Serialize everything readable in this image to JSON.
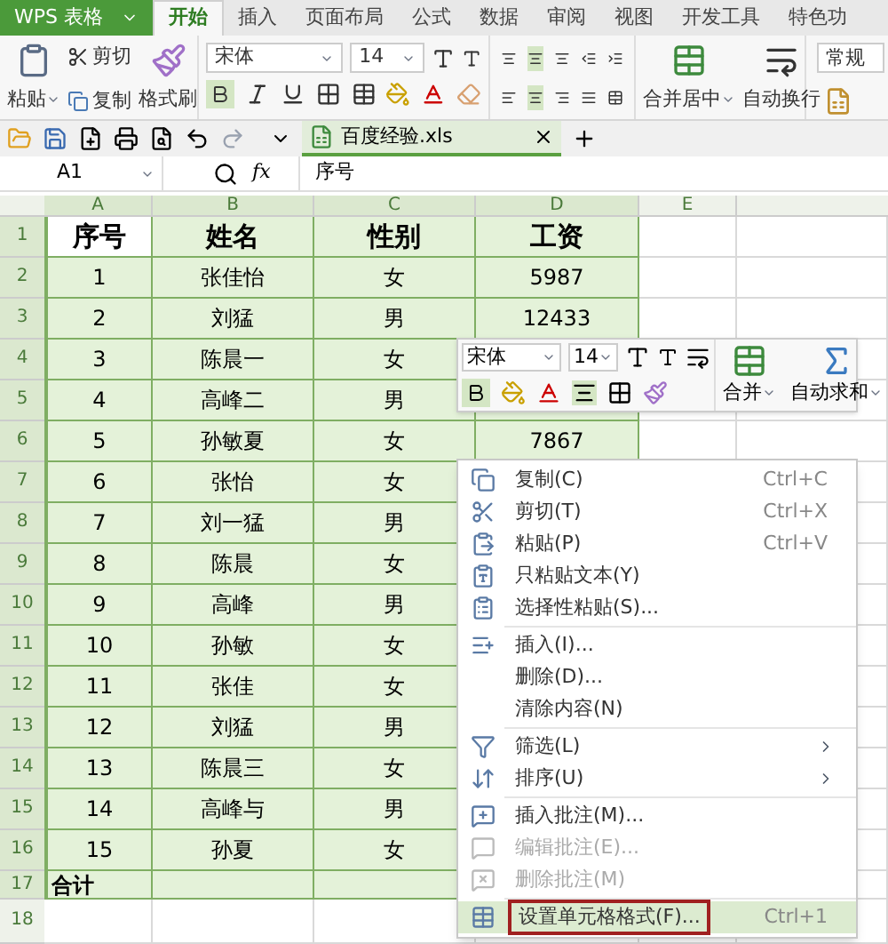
{
  "app_menu": {
    "label": "WPS 表格"
  },
  "tabs": [
    {
      "label": "开始",
      "selected": true
    },
    {
      "label": "插入",
      "selected": false
    },
    {
      "label": "页面布局",
      "selected": false
    },
    {
      "label": "公式",
      "selected": false
    },
    {
      "label": "数据",
      "selected": false
    },
    {
      "label": "审阅",
      "selected": false
    },
    {
      "label": "视图",
      "selected": false
    },
    {
      "label": "开发工具",
      "selected": false
    },
    {
      "label": "特色功",
      "selected": false
    }
  ],
  "ribbon": {
    "paste": "粘贴",
    "cut": "剪切",
    "copy": "复制",
    "format_painter": "格式刷",
    "font": "宋体",
    "size": "14",
    "merge": "合并居中",
    "wrap": "自动换行",
    "number_format": "常规"
  },
  "document_tab": {
    "title": "百度经验.xls"
  },
  "formula_bar": {
    "cell": "A1",
    "fx_label": "fx",
    "formula": "序号"
  },
  "columns": [
    "A",
    "B",
    "C",
    "D",
    "E"
  ],
  "rows": [
    {
      "number": "1",
      "kind": "header",
      "selected": true,
      "cells": [
        "序号",
        "姓名",
        "性别",
        "工资"
      ]
    },
    {
      "number": "2",
      "kind": "data",
      "selected": true,
      "cells": [
        "1",
        "张佳怡",
        "女",
        "5987"
      ]
    },
    {
      "number": "3",
      "kind": "data",
      "selected": true,
      "cells": [
        "2",
        "刘猛",
        "男",
        "12433"
      ]
    },
    {
      "number": "4",
      "kind": "data",
      "selected": true,
      "cells": [
        "3",
        "陈晨一",
        "女"
      ]
    },
    {
      "number": "5",
      "kind": "data",
      "selected": true,
      "cells": [
        "4",
        "高峰二",
        "男"
      ]
    },
    {
      "number": "6",
      "kind": "data",
      "selected": true,
      "cells": [
        "5",
        "孙敏夏",
        "女",
        "7867"
      ]
    },
    {
      "number": "7",
      "kind": "data",
      "selected": true,
      "cells": [
        "6",
        "张怡",
        "女"
      ]
    },
    {
      "number": "8",
      "kind": "data",
      "selected": true,
      "cells": [
        "7",
        "刘一猛",
        "男"
      ]
    },
    {
      "number": "9",
      "kind": "data",
      "selected": true,
      "cells": [
        "8",
        "陈晨",
        "女"
      ]
    },
    {
      "number": "10",
      "kind": "data",
      "selected": true,
      "cells": [
        "9",
        "高峰",
        "男"
      ]
    },
    {
      "number": "11",
      "kind": "data",
      "selected": true,
      "cells": [
        "10",
        "孙敏",
        "女"
      ]
    },
    {
      "number": "12",
      "kind": "data",
      "selected": true,
      "cells": [
        "11",
        "张佳",
        "女"
      ]
    },
    {
      "number": "13",
      "kind": "data",
      "selected": true,
      "cells": [
        "12",
        "刘猛",
        "男"
      ]
    },
    {
      "number": "14",
      "kind": "data",
      "selected": true,
      "cells": [
        "13",
        "陈晨三",
        "女"
      ]
    },
    {
      "number": "15",
      "kind": "data",
      "selected": true,
      "cells": [
        "14",
        "高峰与",
        "男"
      ]
    },
    {
      "number": "16",
      "kind": "data",
      "selected": true,
      "cells": [
        "15",
        "孙夏",
        "女"
      ]
    },
    {
      "number": "17",
      "kind": "total",
      "selected": true,
      "cells": [
        "合计"
      ]
    },
    {
      "number": "18",
      "kind": "data",
      "selected": false
    }
  ],
  "mini_toolbar": {
    "font": "宋体",
    "size": "14",
    "merge": "合并",
    "autosum": "自动求和"
  },
  "context_menu": [
    {
      "kind": "item",
      "label": "复制(C)",
      "shortcut": "Ctrl+C",
      "disabled": false,
      "submenu": false,
      "selected": false
    },
    {
      "kind": "item",
      "label": "剪切(T)",
      "shortcut": "Ctrl+X",
      "disabled": false,
      "submenu": false,
      "selected": false
    },
    {
      "kind": "item",
      "label": "粘贴(P)",
      "shortcut": "Ctrl+V",
      "disabled": false,
      "submenu": false,
      "selected": false
    },
    {
      "kind": "item",
      "label": "只粘贴文本(Y)",
      "disabled": false,
      "submenu": false,
      "selected": false
    },
    {
      "kind": "item",
      "label": "选择性粘贴(S)...",
      "disabled": false,
      "submenu": false,
      "selected": false
    },
    {
      "kind": "separator"
    },
    {
      "kind": "item",
      "label": "插入(I)...",
      "disabled": false,
      "submenu": false,
      "selected": false
    },
    {
      "kind": "item",
      "label": "删除(D)...",
      "disabled": false,
      "submenu": false,
      "selected": false
    },
    {
      "kind": "item",
      "label": "清除内容(N)",
      "disabled": false,
      "submenu": false,
      "selected": false
    },
    {
      "kind": "separator"
    },
    {
      "kind": "item",
      "label": "筛选(L)",
      "disabled": false,
      "submenu": true,
      "selected": false
    },
    {
      "kind": "item",
      "label": "排序(U)",
      "disabled": false,
      "submenu": true,
      "selected": false
    },
    {
      "kind": "separator"
    },
    {
      "kind": "item",
      "label": "插入批注(M)...",
      "disabled": false,
      "submenu": false,
      "selected": false
    },
    {
      "kind": "item",
      "label": "编辑批注(E)...",
      "disabled": true,
      "submenu": false,
      "selected": false
    },
    {
      "kind": "item",
      "label": "删除批注(M)",
      "disabled": true,
      "submenu": false,
      "selected": false
    },
    {
      "kind": "separator"
    },
    {
      "kind": "item",
      "label": "设置单元格格式(F)...",
      "shortcut": "Ctrl+1",
      "disabled": false,
      "submenu": false,
      "selected": true
    }
  ]
}
